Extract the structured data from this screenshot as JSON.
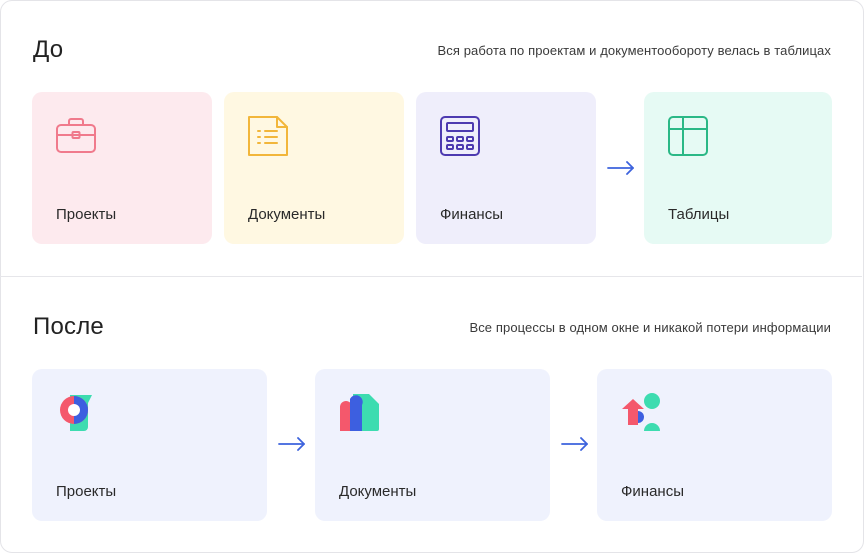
{
  "before": {
    "title": "До",
    "description": "Вся работа по проектам и документообороту велась в таблицах",
    "cards": [
      {
        "label": "Проекты",
        "icon": "briefcase-icon",
        "color": "#fdeaee",
        "accent": "#f07a8c"
      },
      {
        "label": "Документы",
        "icon": "document-list-icon",
        "color": "#fff8e2",
        "accent": "#f2b63a"
      },
      {
        "label": "Финансы",
        "icon": "calculator-icon",
        "color": "#efeefb",
        "accent": "#4d3ab0"
      },
      {
        "label": "Таблицы",
        "icon": "table-icon",
        "color": "#e6faf4",
        "accent": "#2bb886"
      }
    ]
  },
  "after": {
    "title": "После",
    "description": "Все процессы в одном окне и никакой потери информации",
    "cards": [
      {
        "label": "Проекты",
        "icon": "projects-app-icon",
        "color": "#eff2fd"
      },
      {
        "label": "Документы",
        "icon": "documents-app-icon",
        "color": "#eff2fd"
      },
      {
        "label": "Финансы",
        "icon": "finance-app-icon",
        "color": "#eff2fd"
      }
    ]
  },
  "colors": {
    "arrow": "#3d63dd",
    "pink": "#f07a8c",
    "teal": "#3ddcb0",
    "blue": "#3d5fe0",
    "red": "#f4586c"
  }
}
